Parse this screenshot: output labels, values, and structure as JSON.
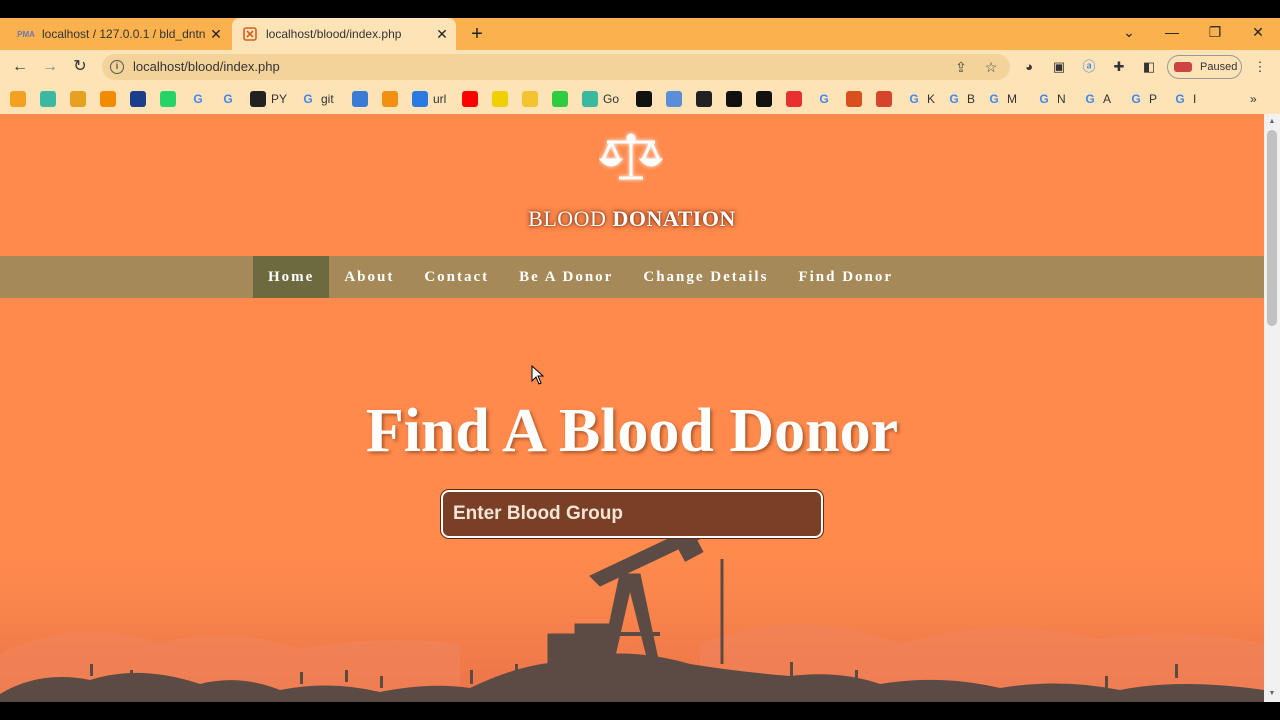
{
  "browser": {
    "tabs": [
      {
        "title": "localhost / 127.0.0.1 / bld_dntn /",
        "favicon": "pma-icon",
        "active": false
      },
      {
        "title": "localhost/blood/index.php",
        "favicon": "xampp-icon",
        "active": true
      }
    ],
    "url": "localhost/blood/index.php",
    "profile_status": "Paused",
    "bookmarks": [
      {
        "label": "",
        "icon": "bm-icon",
        "color": "#f4a020"
      },
      {
        "label": "",
        "icon": "bm-icon",
        "color": "#3bb8a0"
      },
      {
        "label": "",
        "icon": "bm-icon",
        "color": "#e8a020"
      },
      {
        "label": "",
        "icon": "analytics-icon",
        "color": "#f08c00"
      },
      {
        "label": "",
        "icon": "ieee-icon",
        "color": "#1a3d8c"
      },
      {
        "label": "",
        "icon": "whatsapp-icon",
        "color": "#25d366"
      },
      {
        "label": "",
        "icon": "google-icon",
        "color": "#4285f4"
      },
      {
        "label": "",
        "icon": "google-icon",
        "color": "#4285f4"
      },
      {
        "label": "PY",
        "icon": "github-icon",
        "color": "#222222"
      },
      {
        "label": "git",
        "icon": "google-icon",
        "color": "#4285f4"
      },
      {
        "label": "",
        "icon": "bm-icon",
        "color": "#3a7bd5"
      },
      {
        "label": "",
        "icon": "pma-icon",
        "color": "#f29111"
      },
      {
        "label": "url",
        "icon": "bm-icon",
        "color": "#2a7ae2"
      },
      {
        "label": "",
        "icon": "youtube-icon",
        "color": "#ff0000"
      },
      {
        "label": "",
        "icon": "p-icon",
        "color": "#f0d000"
      },
      {
        "label": "",
        "icon": "bm-icon",
        "color": "#f4c430"
      },
      {
        "label": "",
        "icon": "bm-icon",
        "color": "#2ecc40"
      },
      {
        "label": "Go",
        "icon": "bm-icon",
        "color": "#3bb8a0"
      },
      {
        "label": "",
        "icon": "bm-icon",
        "color": "#111111"
      },
      {
        "label": "",
        "icon": "bm-icon",
        "color": "#5b8dd9"
      },
      {
        "label": "",
        "icon": "bm-icon",
        "color": "#222222"
      },
      {
        "label": "",
        "icon": "bm-icon",
        "color": "#111111"
      },
      {
        "label": "",
        "icon": "bm-icon",
        "color": "#111111"
      },
      {
        "label": "",
        "icon": "yandex-icon",
        "color": "#e8312f"
      },
      {
        "label": "",
        "icon": "google-icon",
        "color": "#4285f4"
      },
      {
        "label": "",
        "icon": "bm-icon",
        "color": "#d94f1e"
      },
      {
        "label": "",
        "icon": "eye-icon",
        "color": "#d6452b"
      },
      {
        "label": "K",
        "icon": "google-icon",
        "color": "#4285f4"
      },
      {
        "label": "B",
        "icon": "google-icon",
        "color": "#4285f4"
      },
      {
        "label": "M",
        "icon": "google-icon",
        "color": "#4285f4"
      },
      {
        "label": "N",
        "icon": "google-icon",
        "color": "#4285f4"
      },
      {
        "label": "A",
        "icon": "google-icon",
        "color": "#4285f4"
      },
      {
        "label": "P",
        "icon": "google-icon",
        "color": "#4285f4"
      },
      {
        "label": "I",
        "icon": "google-icon",
        "color": "#4285f4"
      }
    ]
  },
  "site": {
    "title_light": "BLOOD ",
    "title_bold": "DONATION",
    "nav": [
      "Home",
      "About",
      "Contact",
      "Be A Donor",
      "Change Details",
      "Find Donor"
    ],
    "active_nav": "Home",
    "hero_heading": "Find A Blood Donor",
    "search_placeholder": "Enter Blood Group"
  },
  "colors": {
    "page_bg": "#ff8a4c",
    "nav_bg": "#a68958",
    "nav_active": "#6e6a40",
    "search_bg": "#7a4026",
    "tabstrip": "#fbb24e",
    "toolbar": "#fde3b6"
  }
}
